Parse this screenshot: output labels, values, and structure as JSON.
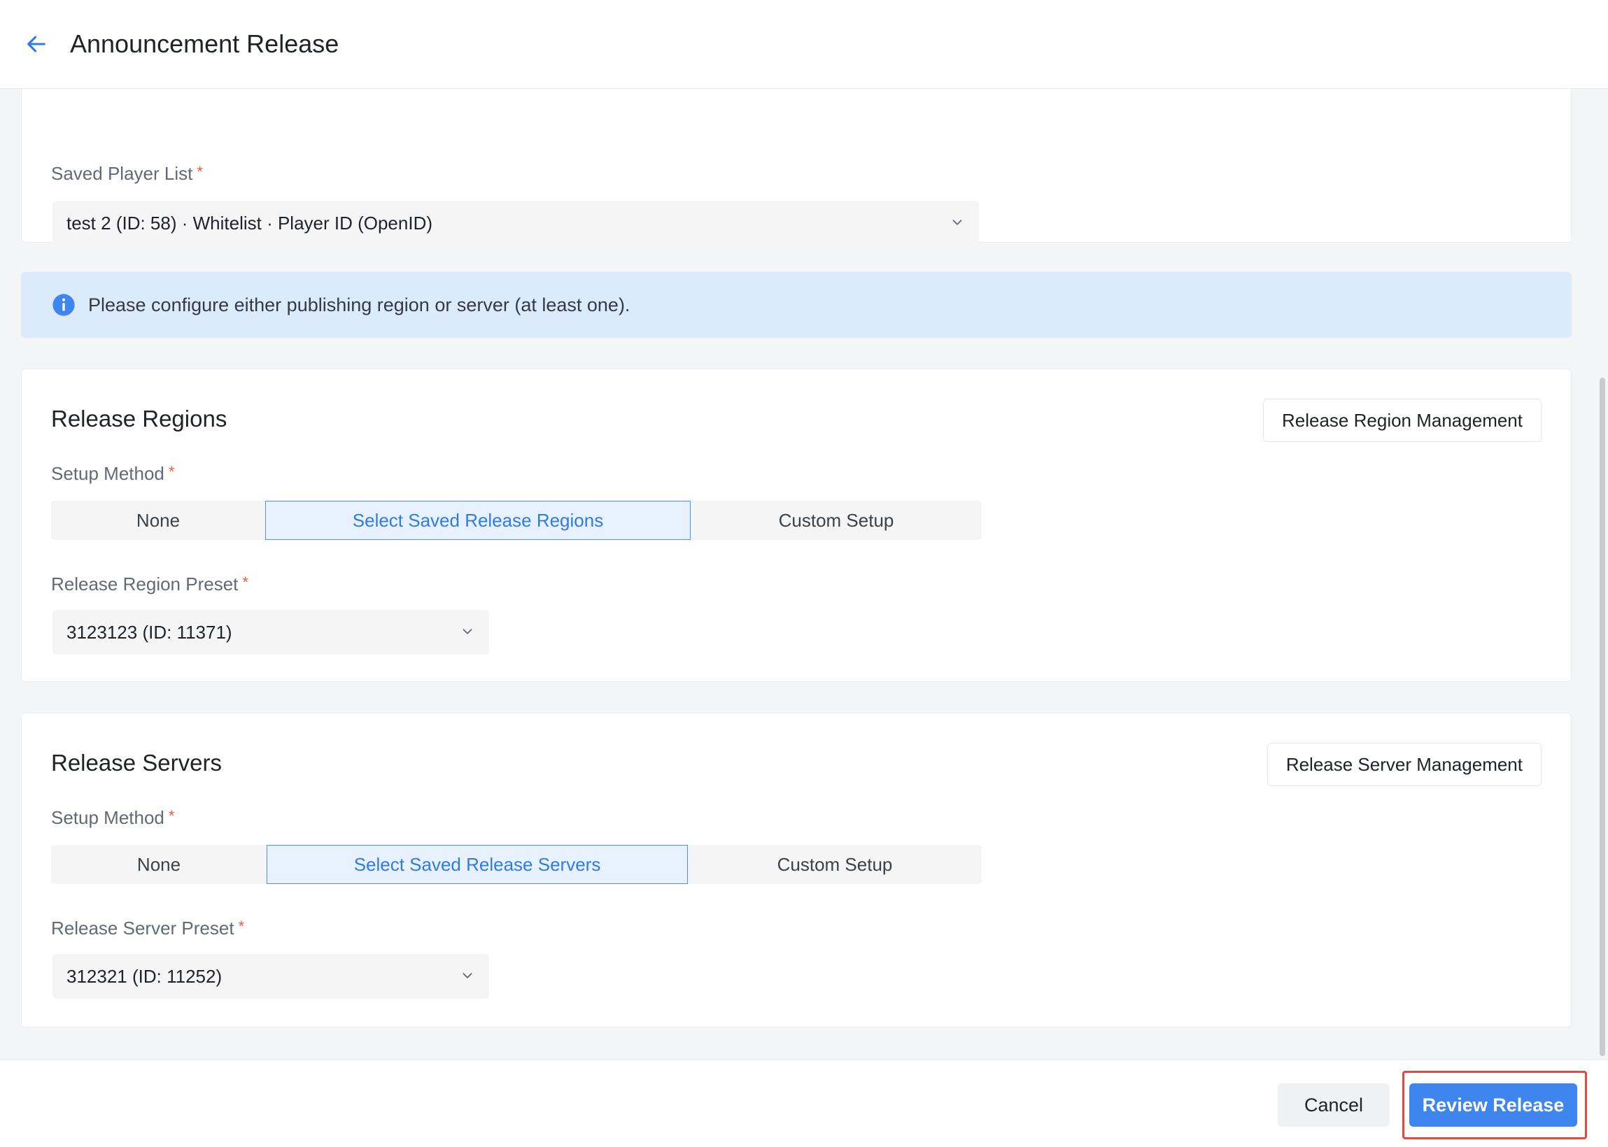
{
  "header": {
    "title": "Announcement Release"
  },
  "player_list": {
    "label": "Saved Player List",
    "required_mark": "*",
    "value": "test 2 (ID: 58) · Whitelist · Player ID (OpenID)"
  },
  "info_banner": {
    "text": "Please configure either publishing region or server (at least one)."
  },
  "regions": {
    "title": "Release Regions",
    "management_button": "Release Region Management",
    "setup_label": "Setup Method",
    "required_mark": "*",
    "options": [
      "None",
      "Select Saved Release Regions",
      "Custom Setup"
    ],
    "selected_option": "Select Saved Release Regions",
    "preset_label": "Release Region Preset",
    "preset_value": "3123123 (ID: 11371)"
  },
  "servers": {
    "title": "Release Servers",
    "management_button": "Release Server Management",
    "setup_label": "Setup Method",
    "required_mark": "*",
    "options": [
      "None",
      "Select Saved Release Servers",
      "Custom Setup"
    ],
    "selected_option": "Select Saved Release Servers",
    "preset_label": "Release Server Preset",
    "preset_value": "312321 (ID: 11252)"
  },
  "footer": {
    "cancel_label": "Cancel",
    "review_label": "Review Release"
  },
  "colors": {
    "accent": "#3f85f0",
    "required": "#f05b3f",
    "info_bg": "#dcebfc",
    "highlight": "#e04a3f"
  },
  "icons": {
    "back": "arrow-left-icon",
    "info": "info-icon",
    "dropdown": "chevron-down-icon"
  }
}
